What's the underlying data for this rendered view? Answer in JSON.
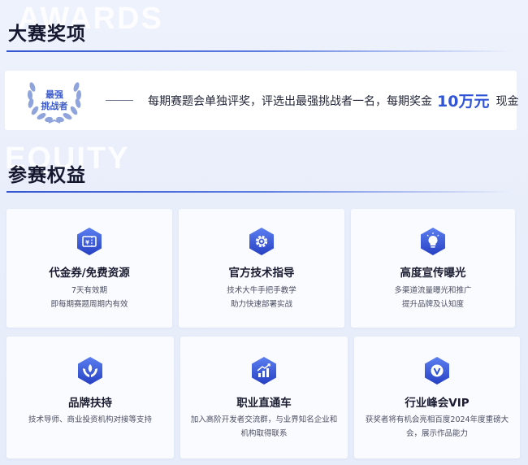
{
  "awards_section": {
    "ghost_text": "AWARDS",
    "title": "大赛奖项",
    "badge_text": [
      "最强",
      "挑战者"
    ],
    "description": "每期赛题会单独评奖，评选出最强挑战者一名，每期奖金",
    "amount": "10万元",
    "suffix": "现金"
  },
  "equity_section": {
    "ghost_text": "EQUITY",
    "title": "参赛权益",
    "cards": [
      {
        "title": "代金券/免费资源",
        "icon": "voucher-icon",
        "desc": [
          "7天有效期",
          "即每期赛题周期内有效"
        ]
      },
      {
        "title": "官方技术指导",
        "icon": "gear-icon",
        "desc": [
          "技术大牛手把手教学",
          "助力快速部署实战"
        ]
      },
      {
        "title": "高度宣传曝光",
        "icon": "lightbulb-icon",
        "desc": [
          "多渠道流量曝光和推广",
          "提升品牌及认知度"
        ]
      },
      {
        "title": "品牌扶持",
        "icon": "hands-support-icon",
        "desc": [
          "技术导师、商业投资机构对接等支持"
        ]
      },
      {
        "title": "职业直通车",
        "icon": "growth-chart-icon",
        "desc": [
          "加入高阶开发者交流群，与业界知名企业和",
          "机构取得联系"
        ]
      },
      {
        "title": "行业峰会VIP",
        "icon": "vip-badge-icon",
        "desc": [
          "获奖者将有机会亮相百度2024年度重磅大",
          "会，展示作品能力"
        ]
      }
    ]
  },
  "colors": {
    "accent": "#2f54d8",
    "icon_gradient_top": "#5b7ff0",
    "icon_gradient_bottom": "#2740c4",
    "badge_laurel": "#8fa4dc",
    "badge_text": "#3f5cc8"
  }
}
